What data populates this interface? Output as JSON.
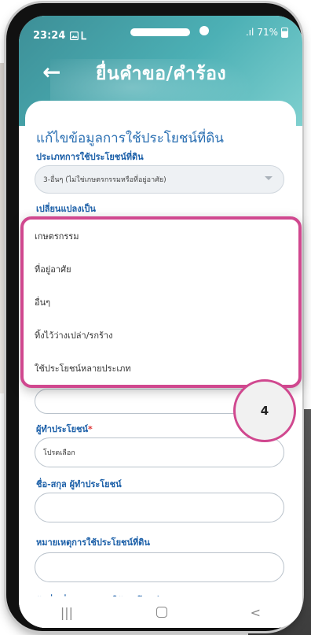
{
  "status_bar": {
    "time": "23:24",
    "signal": ".ıl",
    "battery": "71%"
  },
  "header": {
    "back_icon": "arrow-left-icon",
    "title": "ยื่นคำขอ/คำร้อง"
  },
  "form": {
    "section_title": "แก้ไขข้อมูลการใช้ประโยชน์ที่ดิน",
    "land_use_type": {
      "label": "ประเภทการใช้ประโยชน์ที่ดิน",
      "value": "3-อื่นๆ (ไม่ใช่เกษตรกรรมหรือที่อยู่อาศัย)"
    },
    "change_to": {
      "label": "เปลี่ยนแปลงเป็น"
    },
    "user": {
      "label": "ผู้ทำประโยชน์",
      "required_mark": "*",
      "value": "โปรดเลือก"
    },
    "user_name": {
      "label": "ชื่อ-สกุล ผู้ทำประโยชน์",
      "value": ""
    },
    "remark": {
      "label": "หมายเหตุการใช้ประโยชน์ที่ดิน",
      "value": ""
    },
    "change_date": {
      "label": "วันที่เปลี่ยนแปลงการใช้ประโยชน์"
    }
  },
  "dropdown": {
    "options": [
      "เกษตรกรรม",
      "ที่อยู่อาศัย",
      "อื่นๆ",
      "ทิ้งไว้ว่างเปล่า/รกร้าง",
      "ใช้ประโยชน์หลายประเภท"
    ]
  },
  "step_badge": "4",
  "nav_bar": {
    "recents": "|||",
    "back": "<"
  },
  "colors": {
    "header": "#4cb0b5",
    "label": "#1b5fa8",
    "highlight": "#d0488f"
  }
}
